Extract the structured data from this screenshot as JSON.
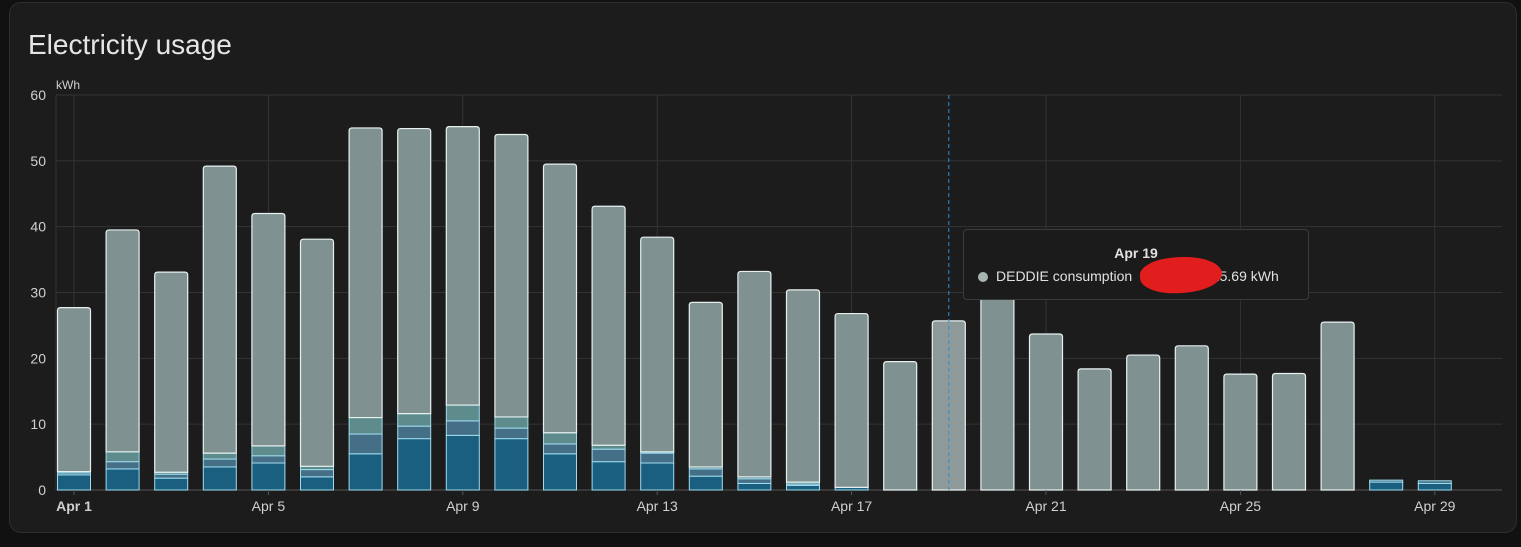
{
  "card": {
    "title": "Electricity usage"
  },
  "chart_data": {
    "type": "bar",
    "stacked": true,
    "ylabel": "kWh",
    "ylim": [
      0,
      60
    ],
    "yticks": [
      0,
      10,
      20,
      30,
      40,
      50,
      60
    ],
    "grid": true,
    "categories": [
      "Apr 1",
      "Apr 2",
      "Apr 3",
      "Apr 4",
      "Apr 5",
      "Apr 6",
      "Apr 7",
      "Apr 8",
      "Apr 9",
      "Apr 10",
      "Apr 11",
      "Apr 12",
      "Apr 13",
      "Apr 14",
      "Apr 15",
      "Apr 16",
      "Apr 17",
      "Apr 18",
      "Apr 19",
      "Apr 20",
      "Apr 21",
      "Apr 22",
      "Apr 23",
      "Apr 24",
      "Apr 25",
      "Apr 26",
      "Apr 27",
      "Apr 28",
      "Apr 29"
    ],
    "xtick_labels": [
      {
        "index": 0,
        "label": "Apr 1",
        "bold": true
      },
      {
        "index": 4,
        "label": "Apr 5"
      },
      {
        "index": 8,
        "label": "Apr 9"
      },
      {
        "index": 12,
        "label": "Apr 13"
      },
      {
        "index": 16,
        "label": "Apr 17"
      },
      {
        "index": 20,
        "label": "Apr 21"
      },
      {
        "index": 24,
        "label": "Apr 25"
      },
      {
        "index": 28,
        "label": "Apr 29"
      }
    ],
    "series": [
      {
        "color": "#1a5f7f",
        "values": [
          2.3,
          3.2,
          1.8,
          3.5,
          4.1,
          2.0,
          5.5,
          7.8,
          8.3,
          7.8,
          5.5,
          4.3,
          4.1,
          2.1,
          1.0,
          0.7,
          0.4,
          0,
          0,
          0,
          0,
          0,
          0,
          0,
          0,
          0,
          0,
          1.2,
          1.0
        ]
      },
      {
        "color": "#456f86",
        "values": [
          0.3,
          1.1,
          0.6,
          1.2,
          1.1,
          1.1,
          3.0,
          1.9,
          2.2,
          1.6,
          1.5,
          1.9,
          1.5,
          1.1,
          0.7,
          0.2,
          0,
          0,
          0,
          0,
          0,
          0,
          0,
          0,
          0,
          0,
          0,
          0.3,
          0.4
        ]
      },
      {
        "color": "#5e8c8d",
        "values": [
          0.2,
          1.5,
          0.3,
          0.9,
          1.5,
          0.5,
          2.5,
          1.9,
          2.4,
          1.7,
          1.7,
          0.6,
          0.2,
          0.3,
          0.3,
          0.3,
          0,
          0,
          0,
          0,
          0,
          0,
          0,
          0,
          0,
          0,
          0,
          0,
          0
        ]
      },
      {
        "color": "#7f9291",
        "name": "DEDDIE consumption",
        "values": [
          24.9,
          33.7,
          30.4,
          43.6,
          35.3,
          34.5,
          44.0,
          43.3,
          42.3,
          42.9,
          40.8,
          36.3,
          32.6,
          25.0,
          31.2,
          29.2,
          26.4,
          19.5,
          25.69,
          29.8,
          23.7,
          18.4,
          20.5,
          21.9,
          17.6,
          17.7,
          25.5,
          0,
          0
        ]
      }
    ],
    "highlight_index": 18,
    "tooltip": {
      "title": "Apr 19",
      "series_name": "DEDDIE consumption",
      "value_text": ": 25.69 kWh"
    }
  }
}
